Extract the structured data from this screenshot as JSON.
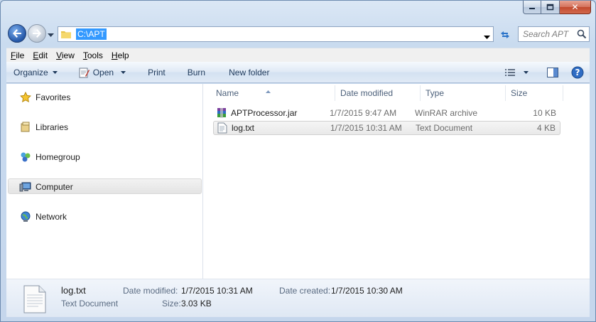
{
  "window": {
    "close_glyph": "✕"
  },
  "address": {
    "path": "C:\\APT"
  },
  "search": {
    "placeholder": "Search APT"
  },
  "menu": [
    {
      "acc": "F",
      "rest": "ile"
    },
    {
      "acc": "E",
      "rest": "dit"
    },
    {
      "acc": "V",
      "rest": "iew"
    },
    {
      "acc": "T",
      "rest": "ools"
    },
    {
      "acc": "H",
      "rest": "elp"
    }
  ],
  "toolbar": {
    "organize": "Organize",
    "open": "Open",
    "print": "Print",
    "burn": "Burn",
    "new_folder": "New folder"
  },
  "nav": {
    "favorites": "Favorites",
    "libraries": "Libraries",
    "homegroup": "Homegroup",
    "computer": "Computer",
    "network": "Network"
  },
  "columns": {
    "name": "Name",
    "date": "Date modified",
    "type": "Type",
    "size": "Size"
  },
  "files": [
    {
      "name": "APTProcessor.jar",
      "date": "1/7/2015 9:47 AM",
      "type": "WinRAR archive",
      "size": "10 KB",
      "icon": "winrar-archive-icon"
    },
    {
      "name": "log.txt",
      "date": "1/7/2015 10:31 AM",
      "type": "Text Document",
      "size": "4 KB",
      "icon": "text-document-icon"
    }
  ],
  "details": {
    "filename": "log.txt",
    "filetype": "Text Document",
    "modified_label": "Date modified:",
    "modified_value": "1/7/2015 10:31 AM",
    "created_label": "Date created:",
    "created_value": "1/7/2015 10:30 AM",
    "size_label": "Size:",
    "size_value": "3.03 KB"
  },
  "colors": {
    "accent": "#3399ff",
    "selection_row": "#e9e9e9"
  }
}
